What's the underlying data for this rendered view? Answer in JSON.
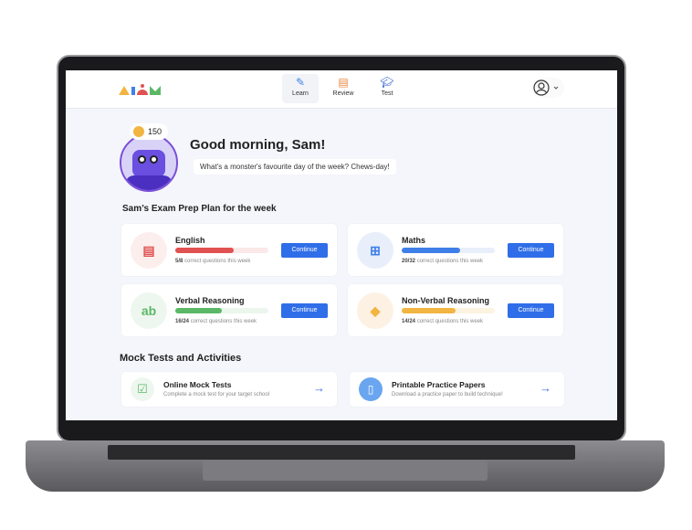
{
  "nav": {
    "items": [
      {
        "label": "Learn",
        "icon": "pencil-icon",
        "active": true
      },
      {
        "label": "Review",
        "icon": "books-icon"
      },
      {
        "label": "Test",
        "icon": "graduation-cap-icon"
      }
    ]
  },
  "logo": "atom",
  "coins": "150",
  "greeting": "Good morning, Sam!",
  "joke": "What's a monster's favourite day of the week? Chews-day!",
  "plan": {
    "title": "Sam’s Exam Prep Plan for the week",
    "subjects": [
      {
        "name": "English",
        "score": "5/8",
        "caption": "correct questions this week",
        "progress": 0.625,
        "color": "#e05252",
        "track": "#fbe8e8",
        "bg": "#fdeeee",
        "button": "Continue"
      },
      {
        "name": "Maths",
        "score": "20/32",
        "caption": "correct questions this week",
        "progress": 0.625,
        "color": "#3f7fe8",
        "track": "#e8effb",
        "bg": "#e8effb",
        "button": "Continue"
      },
      {
        "name": "Verbal Reasoning",
        "score": "16/24",
        "caption": "correct questions this week",
        "progress": 0.5,
        "color": "#5cb867",
        "track": "#ebf6ec",
        "bg": "#eef7ef",
        "button": "Continue"
      },
      {
        "name": "Non-Verbal Reasoning",
        "score": "14/24",
        "caption": "correct questions this week",
        "progress": 0.58,
        "color": "#f2b541",
        "track": "#fdf3e1",
        "bg": "#fdf1e4",
        "button": "Continue"
      }
    ]
  },
  "mock": {
    "title": "Mock Tests and Activities",
    "items": [
      {
        "title": "Online Mock Tests",
        "desc": "Complete a mock test for your target school"
      },
      {
        "title": "Printable Practice Papers",
        "desc": "Download a practice paper to build technique!"
      }
    ]
  }
}
